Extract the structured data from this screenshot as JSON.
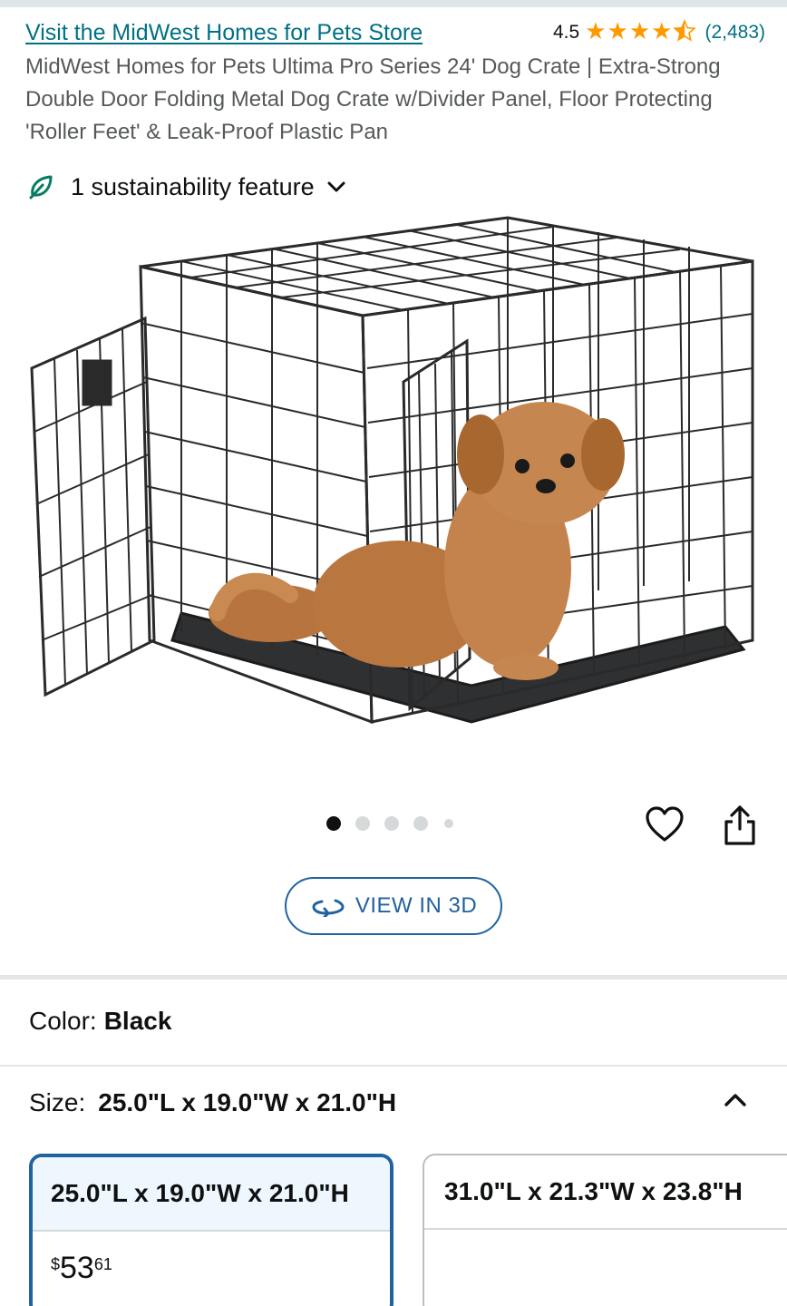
{
  "store": {
    "link_text": "Visit the MidWest Homes for Pets Store"
  },
  "rating": {
    "value": "4.5",
    "stars": 4.5,
    "count": "(2,483)"
  },
  "product": {
    "title": "MidWest Homes for Pets Ultima Pro Series 24' Dog Crate | Extra-Strong Double Door Folding Metal Dog Crate w/Divider Panel, Floor Protecting 'Roller Feet' & Leak-Proof Plastic Pan"
  },
  "sustainability": {
    "label": "1 sustainability feature"
  },
  "carousel": {
    "total": 5,
    "active_index": 0
  },
  "view3d": {
    "label": "VIEW IN 3D"
  },
  "color": {
    "label": "Color:",
    "value": "Black"
  },
  "size": {
    "label": "Size:",
    "value": "25.0\"L x 19.0\"W x 21.0\"H",
    "options": [
      {
        "label": "25.0\"L x 19.0\"W x 21.0\"H",
        "price_symbol": "$",
        "price_whole": "53",
        "price_fraction": "61",
        "selected": true
      },
      {
        "label": "31.0\"L x 21.3\"W x 23.8\"H",
        "selected": false
      }
    ]
  },
  "colors": {
    "link": "#007185",
    "star": "#ff9900",
    "accent": "#2162a1",
    "leaf": "#067d62"
  }
}
